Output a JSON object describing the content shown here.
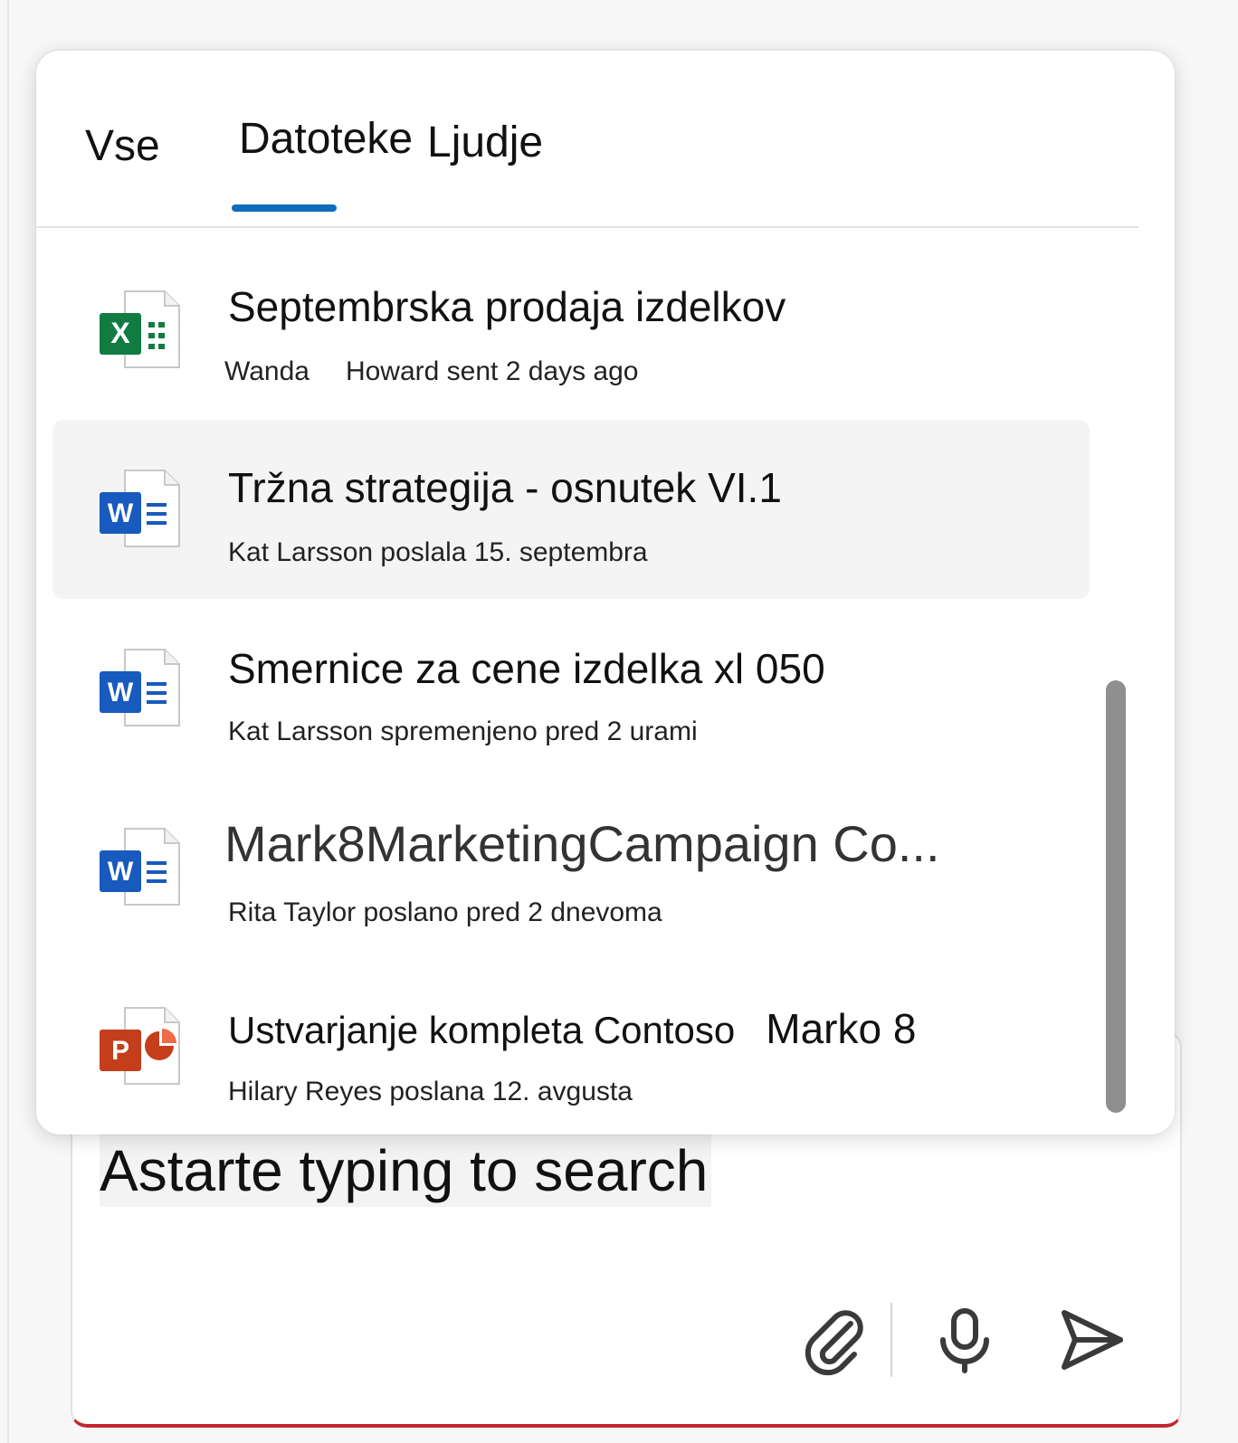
{
  "tabs": {
    "all": "Vse",
    "files": "Datoteke",
    "people": "Ljudje",
    "active": "Datoteke"
  },
  "files": [
    {
      "type": "excel",
      "letter": "X",
      "title": "Septembrska prodaja izdelkov",
      "title_extra": "",
      "sub_a": "Wanda",
      "sub_b": "Howard sent 2 days ago"
    },
    {
      "type": "word",
      "letter": "W",
      "title": "Tržna strategija - osnutek VI.1",
      "title_extra": "",
      "sub_a": "Kat Larsson poslala 15. septembra",
      "sub_b": ""
    },
    {
      "type": "word",
      "letter": "W",
      "title": "Smernice za cene izdelka xl 050",
      "title_extra": "",
      "sub_a": "Kat Larsson spremenjeno pred 2 urami",
      "sub_b": ""
    },
    {
      "type": "word",
      "letter": "W",
      "title": "Mark8MarketingCampaign Co...",
      "title_extra": "",
      "sub_a": "Rita Taylor poslano pred 2 dnevoma",
      "sub_b": ""
    },
    {
      "type": "powerpoint",
      "letter": "P",
      "title": "Ustvarjanje kompleta Contoso",
      "title_extra": "Marko 8",
      "sub_a": "Hilary Reyes poslana 12. avgusta",
      "sub_b": ""
    }
  ],
  "compose": {
    "input_text": "Astarte typing to search",
    "actions": [
      "paperclip-icon",
      "microphone-icon",
      "send-icon"
    ]
  },
  "colors": {
    "accent": "#0f6cbd",
    "excel": "#107c41",
    "word": "#185abd",
    "powerpoint": "#c43e1c",
    "compose_border": "#c4262e"
  }
}
